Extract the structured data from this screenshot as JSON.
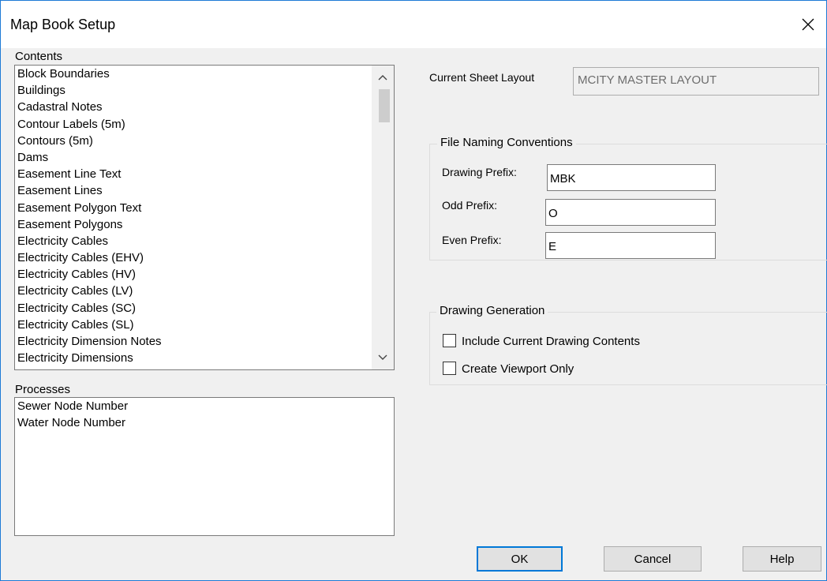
{
  "window": {
    "title": "Map Book Setup"
  },
  "contents": {
    "label": "Contents",
    "items": [
      "Block Boundaries",
      "Buildings",
      "Cadastral Notes",
      "Contour Labels (5m)",
      "Contours (5m)",
      "Dams",
      "Easement Line Text",
      "Easement Lines",
      "Easement Polygon Text",
      "Easement Polygons",
      "Electricity Cables",
      "Electricity Cables (EHV)",
      "Electricity Cables (HV)",
      "Electricity Cables (LV)",
      "Electricity Cables (SC)",
      "Electricity Cables (SL)",
      "Electricity Dimension Notes",
      "Electricity Dimensions"
    ]
  },
  "processes": {
    "label": "Processes",
    "items": [
      "Sewer Node Number",
      "Water Node Number"
    ]
  },
  "sheet_layout": {
    "label": "Current Sheet Layout",
    "value": "MCITY MASTER LAYOUT"
  },
  "file_naming": {
    "legend": "File Naming Conventions",
    "drawing_prefix_label": "Drawing Prefix:",
    "drawing_prefix_value": "MBK",
    "odd_prefix_label": "Odd Prefix:",
    "odd_prefix_value": "O",
    "even_prefix_label": "Even Prefix:",
    "even_prefix_value": "E"
  },
  "drawing_generation": {
    "legend": "Drawing Generation",
    "include_label": "Include Current Drawing Contents",
    "include_checked": false,
    "viewport_label": "Create Viewport Only",
    "viewport_checked": false
  },
  "buttons": {
    "ok": "OK",
    "cancel": "Cancel",
    "help": "Help"
  },
  "icons": {
    "close": "close-icon",
    "scroll_up": "chevron-up-icon",
    "scroll_down": "chevron-down-icon"
  }
}
